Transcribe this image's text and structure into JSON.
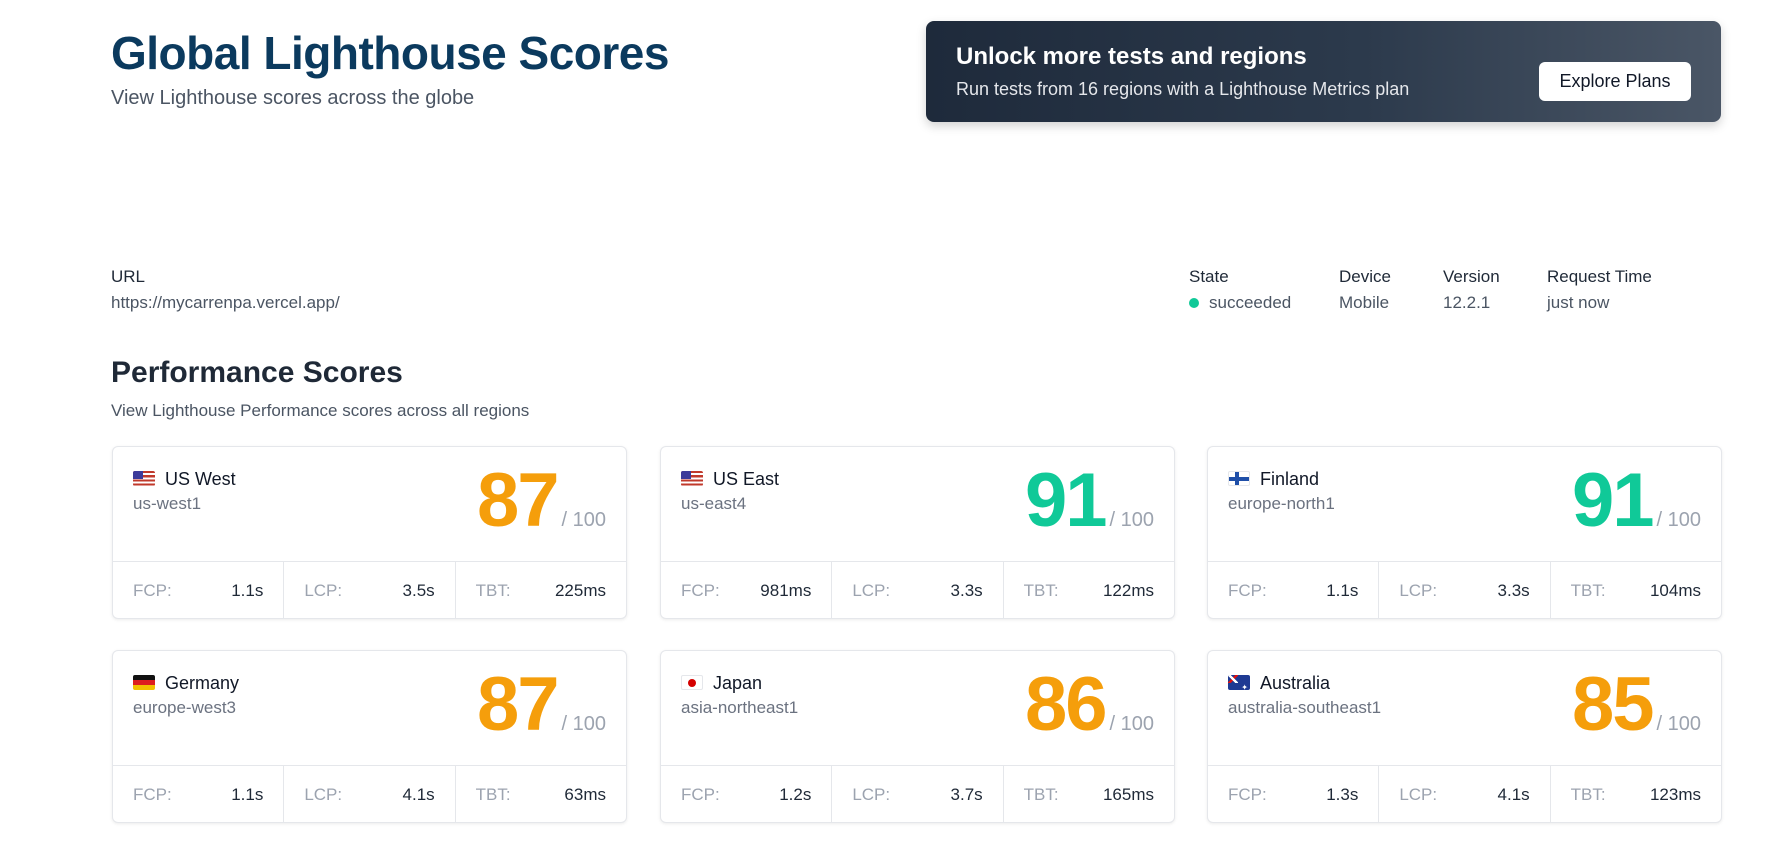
{
  "header": {
    "title": "Global Lighthouse Scores",
    "subtitle": "View Lighthouse scores across the globe"
  },
  "promo": {
    "title": "Unlock more tests and regions",
    "text": "Run tests from 16 regions with a Lighthouse Metrics plan",
    "button_label": "Explore Plans"
  },
  "meta": {
    "url_label": "URL",
    "url_value": "https://mycarrenpa.vercel.app/",
    "state_label": "State",
    "state_value": "succeeded",
    "device_label": "Device",
    "device_value": "Mobile",
    "version_label": "Version",
    "version_value": "12.2.1",
    "request_time_label": "Request Time",
    "request_time_value": "just now",
    "state_color": "#10c998"
  },
  "performance": {
    "title": "Performance Scores",
    "subtitle": "View Lighthouse Performance scores across all regions",
    "score_max": "/ 100",
    "metric_labels": {
      "fcp": "FCP:",
      "lcp": "LCP:",
      "tbt": "TBT:"
    },
    "colors": {
      "good": "#10c998",
      "average": "#f59e0b"
    },
    "regions": [
      {
        "name": "US West",
        "code": "us-west1",
        "flag": "us-flag-icon",
        "score": "87",
        "fcp": "1.1s",
        "lcp": "3.5s",
        "tbt": "225ms"
      },
      {
        "name": "US East",
        "code": "us-east4",
        "flag": "us-flag-icon",
        "score": "91",
        "fcp": "981ms",
        "lcp": "3.3s",
        "tbt": "122ms"
      },
      {
        "name": "Finland",
        "code": "europe-north1",
        "flag": "finland-flag-icon",
        "score": "91",
        "fcp": "1.1s",
        "lcp": "3.3s",
        "tbt": "104ms"
      },
      {
        "name": "Germany",
        "code": "europe-west3",
        "flag": "germany-flag-icon",
        "score": "87",
        "fcp": "1.1s",
        "lcp": "4.1s",
        "tbt": "63ms"
      },
      {
        "name": "Japan",
        "code": "asia-northeast1",
        "flag": "japan-flag-icon",
        "score": "86",
        "fcp": "1.2s",
        "lcp": "3.7s",
        "tbt": "165ms"
      },
      {
        "name": "Australia",
        "code": "australia-southeast1",
        "flag": "australia-flag-icon",
        "score": "85",
        "fcp": "1.3s",
        "lcp": "4.1s",
        "tbt": "123ms"
      }
    ]
  }
}
